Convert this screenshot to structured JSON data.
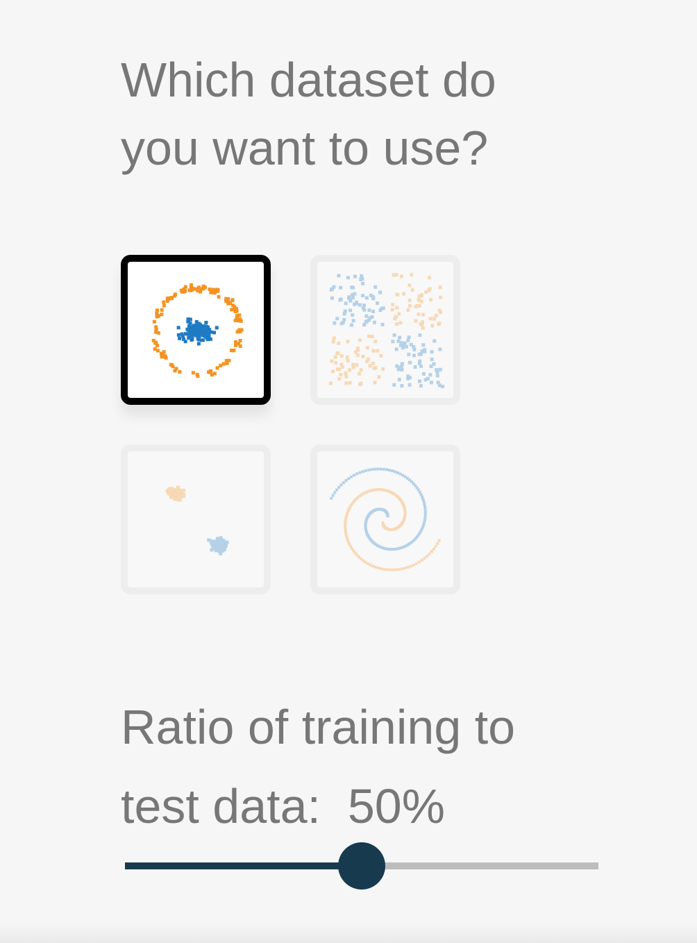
{
  "dataset_section": {
    "heading_line1": "Which dataset do",
    "heading_line2": "you want to use?",
    "datasets": [
      {
        "name": "circle",
        "selected": true
      },
      {
        "name": "xor",
        "selected": false
      },
      {
        "name": "gaussian",
        "selected": false
      },
      {
        "name": "spiral",
        "selected": false
      }
    ]
  },
  "ratio_section": {
    "label_line1": "Ratio of training to",
    "label_line2_prefix": "test data:  ",
    "value_text": "50%",
    "value": 50,
    "min": 10,
    "max": 90
  },
  "colors": {
    "class_orange": "#f59322",
    "class_blue": "#1f7ac4",
    "slider_active": "#183a4f",
    "slider_track": "#bdbdbd",
    "text": "#777777",
    "background": "#f6f6f6"
  }
}
